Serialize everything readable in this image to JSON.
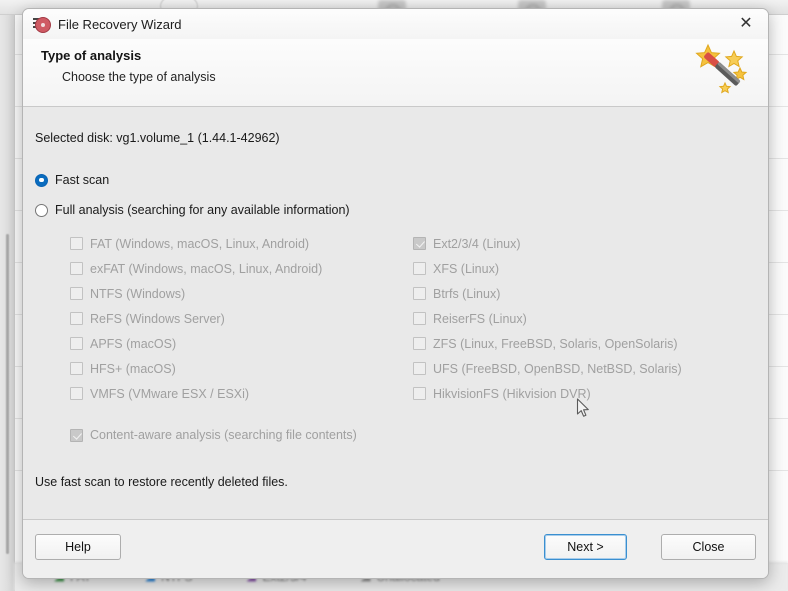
{
  "background": {
    "legend": {
      "items": [
        {
          "label": "FAT",
          "color": "#2e8b3a"
        },
        {
          "label": "NTFS",
          "color": "#1478d4"
        },
        {
          "label": "Ext2/3/4",
          "color": "#7b3fa0"
        },
        {
          "label": "Unallocated",
          "color": "#8a8a8a"
        }
      ]
    }
  },
  "dialog": {
    "titlebar": {
      "title": "File Recovery Wizard",
      "icon": "disc-recovery-icon",
      "close_label": "✕"
    },
    "header": {
      "title": "Type of analysis",
      "subtitle": "Choose the type of analysis",
      "icon": "magic-wand-icon"
    },
    "body": {
      "selected_disk": "Selected disk: vg1.volume_1 (1.44.1-42962)",
      "scan_options": [
        {
          "label": "Fast scan",
          "selected": true
        },
        {
          "label": "Full analysis (searching for any available information)",
          "selected": false
        }
      ],
      "filesystems_left": [
        {
          "label": "FAT (Windows, macOS, Linux, Android)",
          "checked": false,
          "enabled": false
        },
        {
          "label": "exFAT (Windows, macOS, Linux, Android)",
          "checked": false,
          "enabled": false
        },
        {
          "label": "NTFS (Windows)",
          "checked": false,
          "enabled": false
        },
        {
          "label": "ReFS (Windows Server)",
          "checked": false,
          "enabled": false
        },
        {
          "label": "APFS (macOS)",
          "checked": false,
          "enabled": false
        },
        {
          "label": "HFS+ (macOS)",
          "checked": false,
          "enabled": false
        },
        {
          "label": "VMFS (VMware ESX / ESXi)",
          "checked": false,
          "enabled": false
        }
      ],
      "filesystems_right": [
        {
          "label": "Ext2/3/4 (Linux)",
          "checked": true,
          "enabled": false
        },
        {
          "label": "XFS (Linux)",
          "checked": false,
          "enabled": false
        },
        {
          "label": "Btrfs (Linux)",
          "checked": false,
          "enabled": false
        },
        {
          "label": "ReiserFS (Linux)",
          "checked": false,
          "enabled": false
        },
        {
          "label": "ZFS (Linux, FreeBSD, Solaris, OpenSolaris)",
          "checked": false,
          "enabled": false
        },
        {
          "label": "UFS (FreeBSD, OpenBSD, NetBSD, Solaris)",
          "checked": false,
          "enabled": false
        },
        {
          "label": "HikvisionFS (Hikvision DVR)",
          "checked": false,
          "enabled": false
        }
      ],
      "content_aware": {
        "label": "Content-aware analysis (searching file contents)",
        "checked": true,
        "enabled": false
      },
      "hint": "Use fast scan to restore recently deleted files."
    },
    "footer": {
      "help_label": "Help",
      "next_label": "Next >",
      "close_label": "Close"
    }
  },
  "colors": {
    "accent": "#0a6cbe",
    "dialog_bg": "#e9e9e9",
    "disabled_text": "#a0a0a0"
  }
}
